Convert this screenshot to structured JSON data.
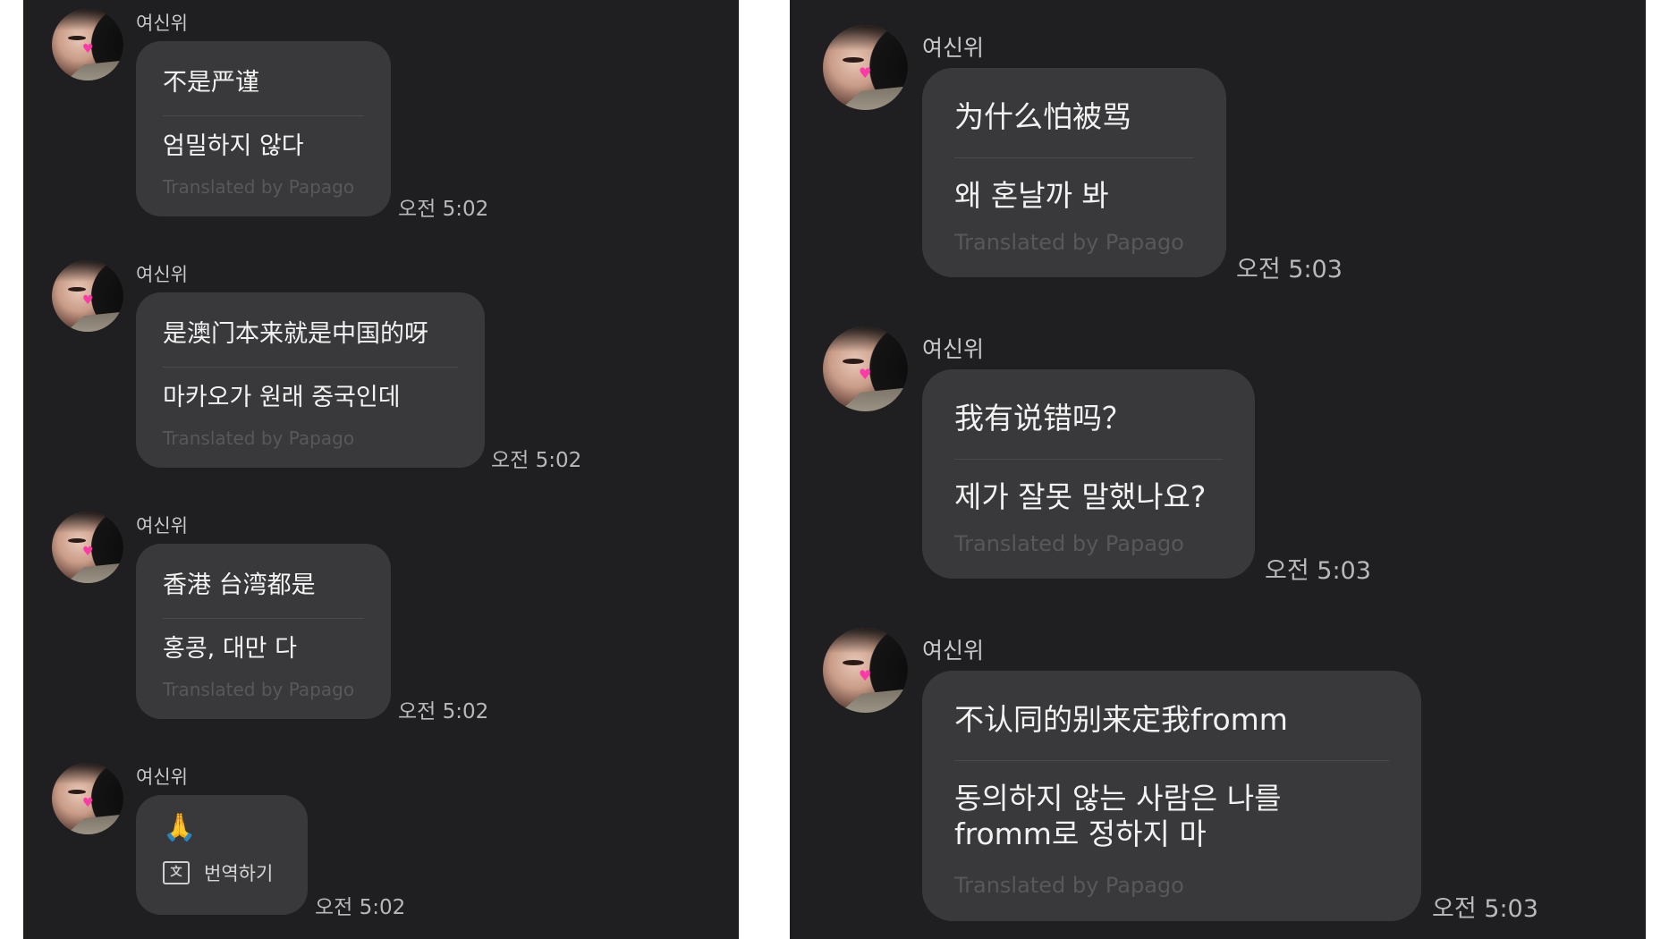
{
  "left_panel": {
    "messages": [
      {
        "sender": "여신위",
        "original": "不是严谨",
        "translation": "엄밀하지 않다",
        "credit": "Translated by Papago",
        "time": "오전 5:02"
      },
      {
        "sender": "여신위",
        "original": "是澳门本来就是中国的呀",
        "translation": "마카오가 원래 중국인데",
        "credit": "Translated by Papago",
        "time": "오전 5:02"
      },
      {
        "sender": "여신위",
        "original": "香港 台湾都是",
        "translation": "홍콩, 대만 다",
        "credit": "Translated by Papago",
        "time": "오전 5:02"
      },
      {
        "sender": "여신위",
        "emoji": "🙏",
        "translate_label": "번역하기",
        "time": "오전 5:02"
      }
    ]
  },
  "right_panel": {
    "messages": [
      {
        "sender": "여신위",
        "original": "为什么怕被骂",
        "translation": "왜 혼날까 봐",
        "credit": "Translated by Papago",
        "time": "오전 5:03"
      },
      {
        "sender": "여신위",
        "original": "我有说错吗？",
        "translation": "제가 잘못 말했나요?",
        "credit": "Translated by Papago",
        "time": "오전 5:03"
      },
      {
        "sender": "여신위",
        "original": "不认同的别来定我fromm",
        "translation_line1": "동의하지 않는 사람은 나를",
        "translation_line2": "fromm로 정하지 마",
        "credit": "Translated by Papago",
        "time": "오전 5:03"
      }
    ]
  },
  "colors": {
    "panel_background": "#1f1f21",
    "bubble_background": "#39393b",
    "message_text": "#f2f2f2",
    "credit_text": "#58585c",
    "time_text": "#b9b9bb"
  },
  "icons": [
    "avatar",
    "translate-icon",
    "folded-hands-emoji"
  ]
}
